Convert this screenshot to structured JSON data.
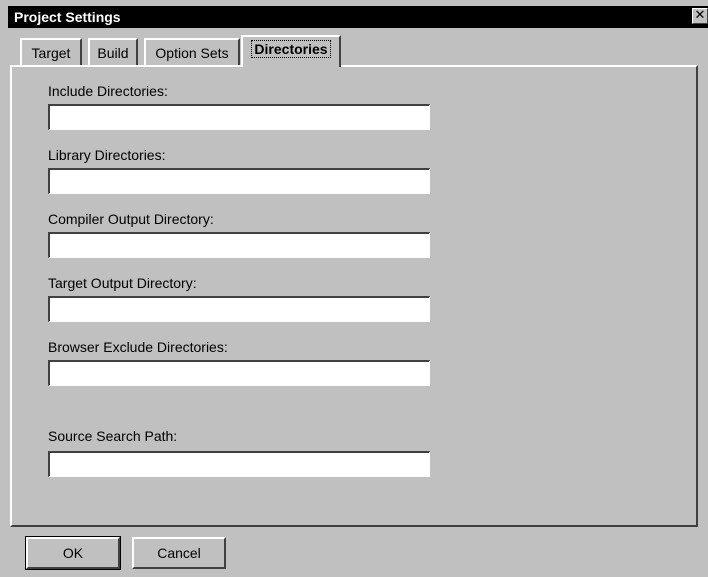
{
  "window": {
    "title": "Project Settings",
    "close_glyph": "✕"
  },
  "tabs": [
    {
      "label": "Target",
      "active": false
    },
    {
      "label": "Build",
      "active": false
    },
    {
      "label": "Option Sets",
      "active": false
    },
    {
      "label": "Directories",
      "active": true
    }
  ],
  "fields": [
    {
      "label": "Include Directories:",
      "value": ""
    },
    {
      "label": "Library Directories:",
      "value": ""
    },
    {
      "label": "Compiler Output Directory:",
      "value": ""
    },
    {
      "label": "Target Output Directory:",
      "value": ""
    },
    {
      "label": "Browser Exclude Directories:",
      "value": ""
    },
    {
      "label": "Source Search Path:",
      "value": ""
    }
  ],
  "buttons": {
    "ok": "OK",
    "cancel": "Cancel"
  }
}
